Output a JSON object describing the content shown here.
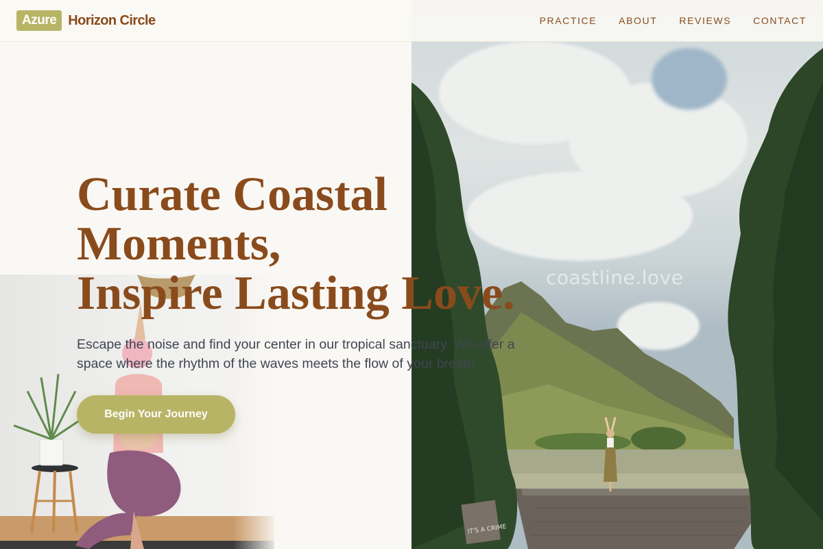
{
  "brand": {
    "badge": "Azure",
    "name": "Horizon Circle",
    "accent": "#b8b466",
    "primary": "#8a4b1c"
  },
  "nav": {
    "items": [
      {
        "label": "PRACTICE"
      },
      {
        "label": "ABOUT"
      },
      {
        "label": "REVIEWS"
      },
      {
        "label": "CONTACT"
      }
    ]
  },
  "hero": {
    "title_lines": [
      "Curate Coastal",
      "Moments,",
      "Inspire Lasting Love."
    ],
    "subtitle": "Escape the noise and find your center in our tropical sanctuary. We offer a space where the rhythm of the waves meets the flow of your breath.",
    "cta_label": "Begin Your Journey"
  },
  "photo": {
    "watermark": "coastline.love"
  },
  "sign": {
    "text": "IT'S A CRIME"
  }
}
